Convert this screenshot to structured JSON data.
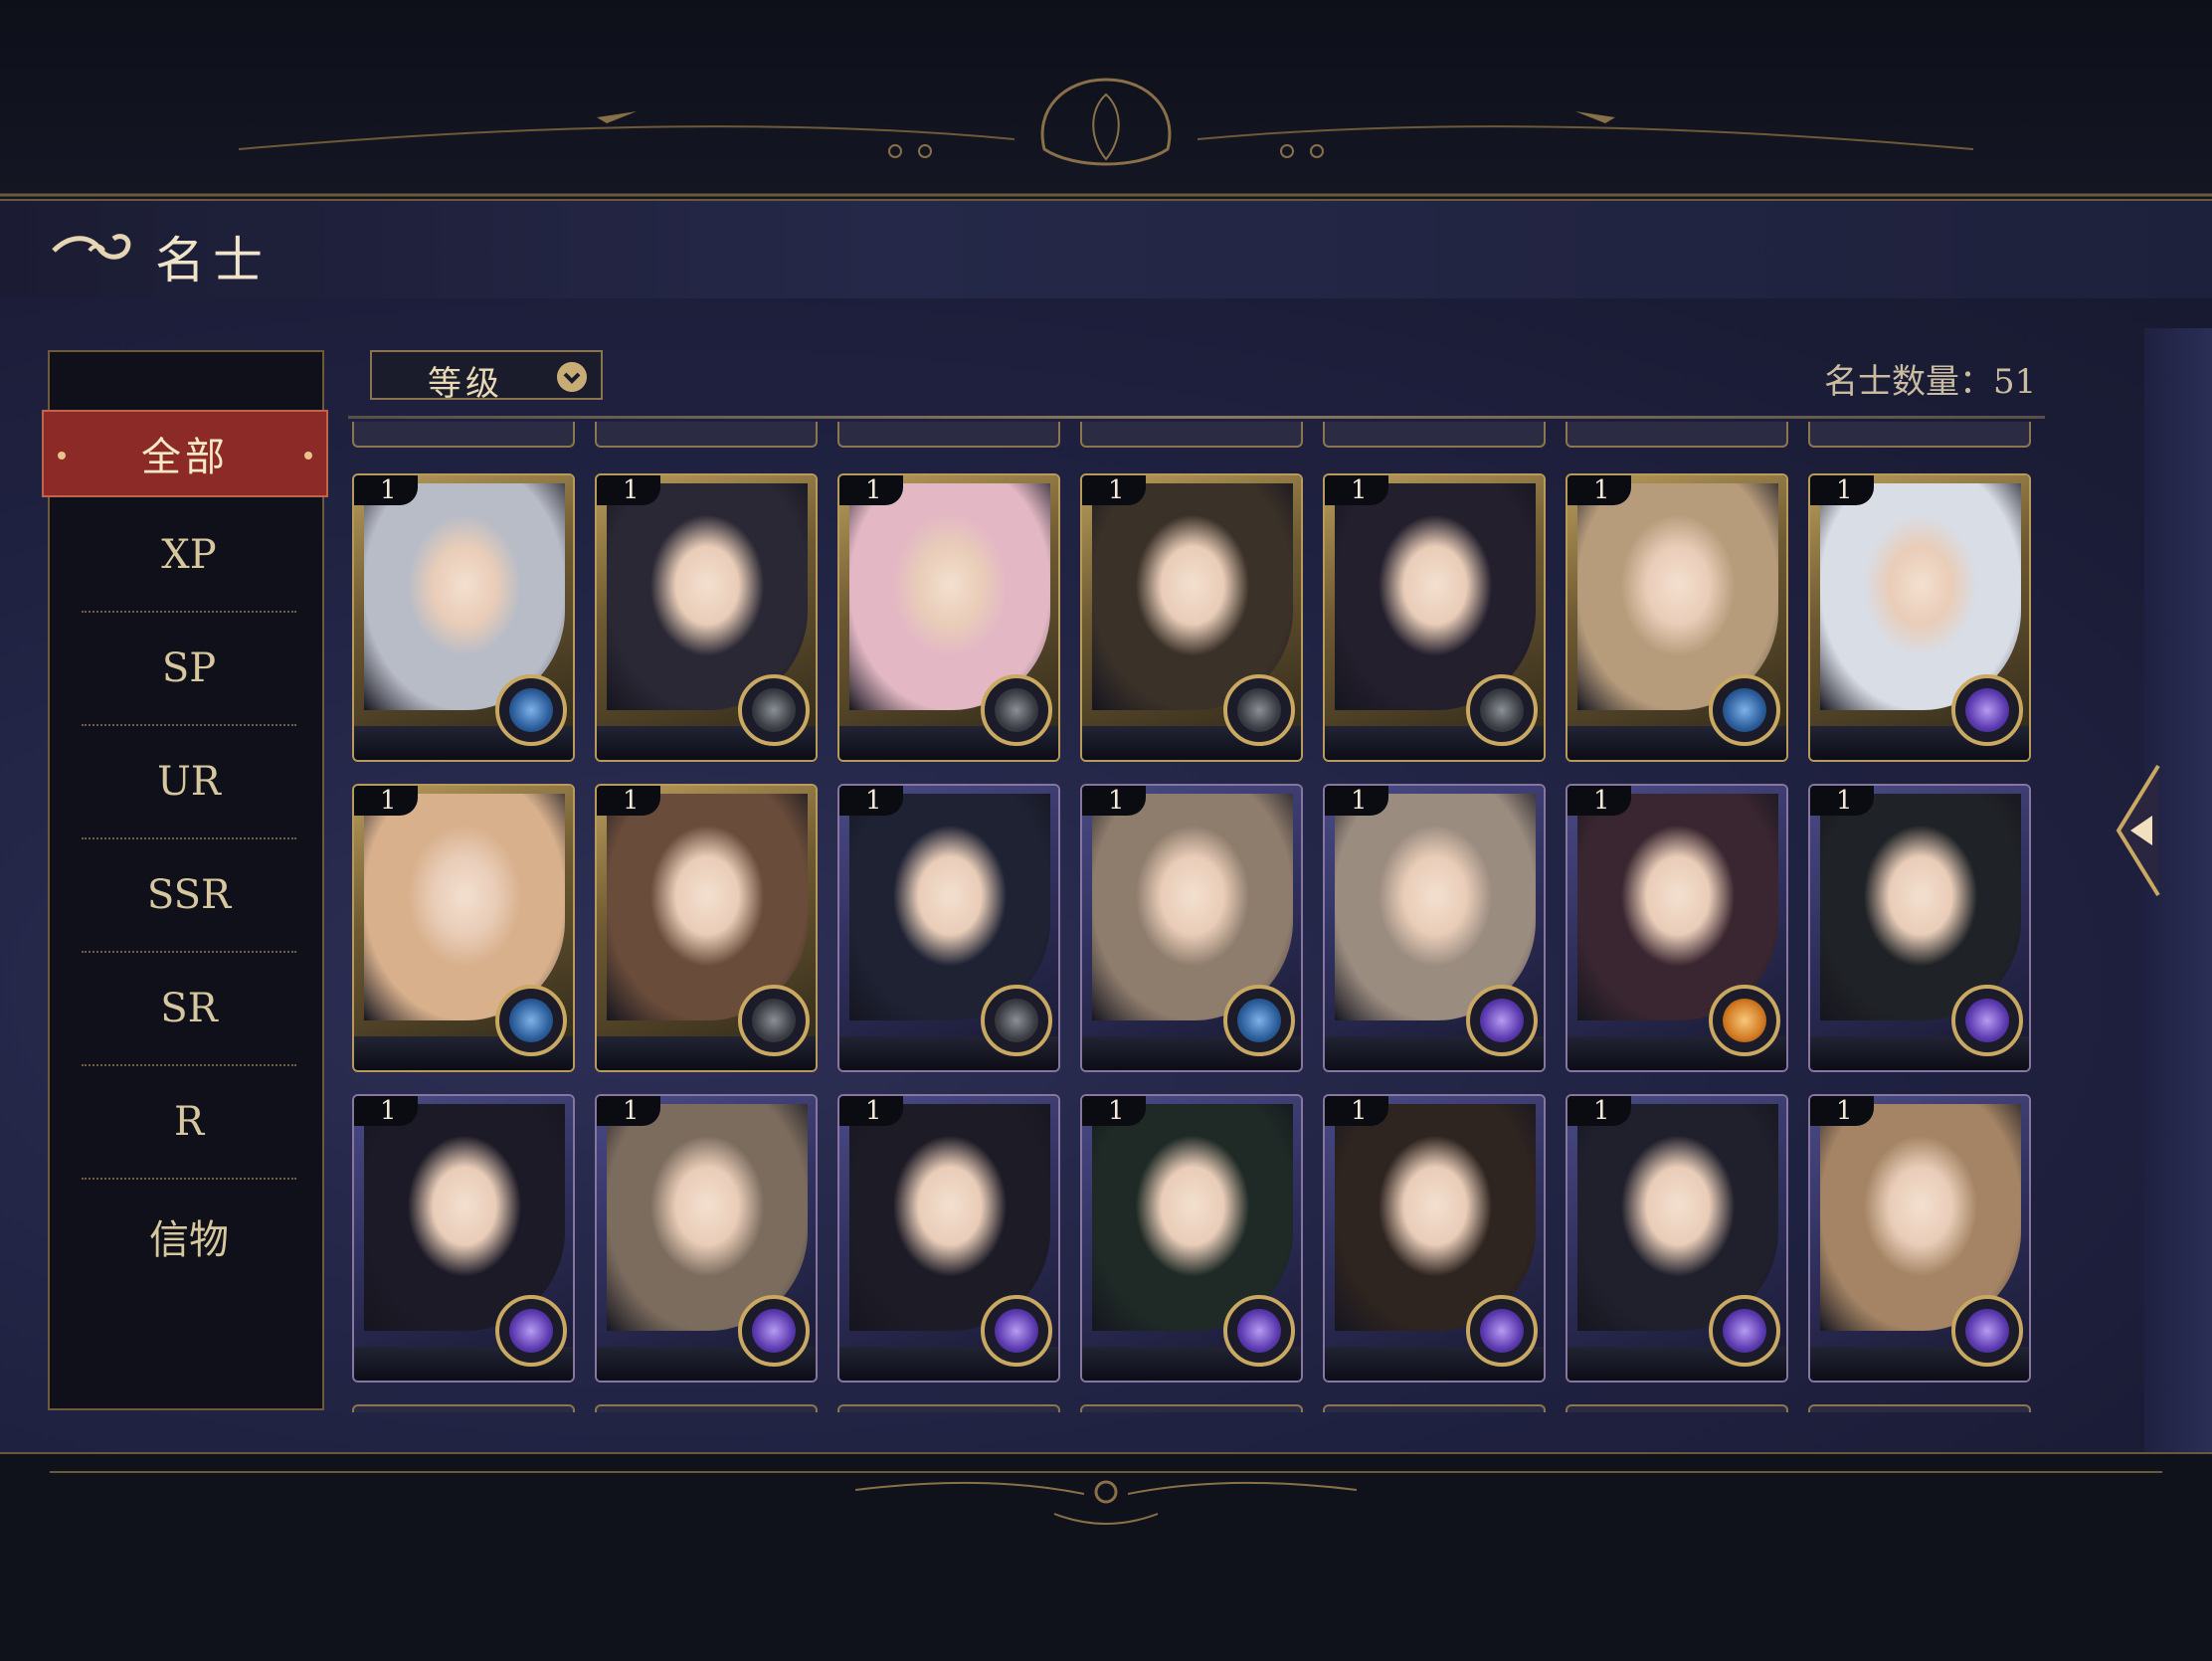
{
  "header": {
    "title": "名士"
  },
  "sidebar": {
    "active": "全部",
    "items": [
      {
        "label": "XP"
      },
      {
        "label": "SP"
      },
      {
        "label": "UR"
      },
      {
        "label": "SSR"
      },
      {
        "label": "SR"
      },
      {
        "label": "R"
      },
      {
        "label": "信物"
      }
    ]
  },
  "toolbar": {
    "sort_label": "等级",
    "sort_icon": "chevron-down-icon"
  },
  "count_label": "名士数量：51",
  "colors": {
    "gold": "#c9a862",
    "active_tab": "#8b2a27",
    "panel": "#1f2140"
  },
  "cards": [
    {
      "level": "1",
      "frame": "gold",
      "badge": "blue-compass",
      "hair": "#b8bcc6"
    },
    {
      "level": "1",
      "frame": "gold",
      "badge": "dark-compass",
      "hair": "#2a2834"
    },
    {
      "level": "1",
      "frame": "gold",
      "badge": "dark-compass",
      "hair": "#e3b8c4"
    },
    {
      "level": "1",
      "frame": "gold",
      "badge": "dark-compass",
      "hair": "#3a3128"
    },
    {
      "level": "1",
      "frame": "gold",
      "badge": "dark-compass",
      "hair": "#231f2c"
    },
    {
      "level": "1",
      "frame": "gold",
      "badge": "blue-compass",
      "hair": "#b79c7c"
    },
    {
      "level": "1",
      "frame": "gold",
      "badge": "purple-planet",
      "hair": "#d9dde6"
    },
    {
      "level": "1",
      "frame": "gold",
      "badge": "blue-compass",
      "hair": "#d8b08c"
    },
    {
      "level": "1",
      "frame": "gold",
      "badge": "dark-compass",
      "hair": "#6a4c3a"
    },
    {
      "level": "1",
      "frame": "purple",
      "badge": "dark-compass",
      "hair": "#1e2233"
    },
    {
      "level": "1",
      "frame": "purple",
      "badge": "blue-compass",
      "hair": "#8e7c6c"
    },
    {
      "level": "1",
      "frame": "purple",
      "badge": "purple-planet",
      "hair": "#9b8c80"
    },
    {
      "level": "1",
      "frame": "purple",
      "badge": "orange-planet",
      "hair": "#3a2630"
    },
    {
      "level": "1",
      "frame": "purple",
      "badge": "purple-planet",
      "hair": "#1f2226"
    },
    {
      "level": "1",
      "frame": "purple",
      "badge": "purple-planet",
      "hair": "#1c1a26"
    },
    {
      "level": "1",
      "frame": "purple",
      "badge": "purple-planet",
      "hair": "#7c6c5e"
    },
    {
      "level": "1",
      "frame": "purple",
      "badge": "purple-planet",
      "hair": "#1d1b26"
    },
    {
      "level": "1",
      "frame": "purple",
      "badge": "purple-planet",
      "hair": "#1f2a26"
    },
    {
      "level": "1",
      "frame": "purple",
      "badge": "purple-planet",
      "hair": "#2e2420"
    },
    {
      "level": "1",
      "frame": "purple",
      "badge": "purple-planet",
      "hair": "#20202c"
    },
    {
      "level": "1",
      "frame": "purple",
      "badge": "purple-planet",
      "hair": "#a48464"
    }
  ]
}
